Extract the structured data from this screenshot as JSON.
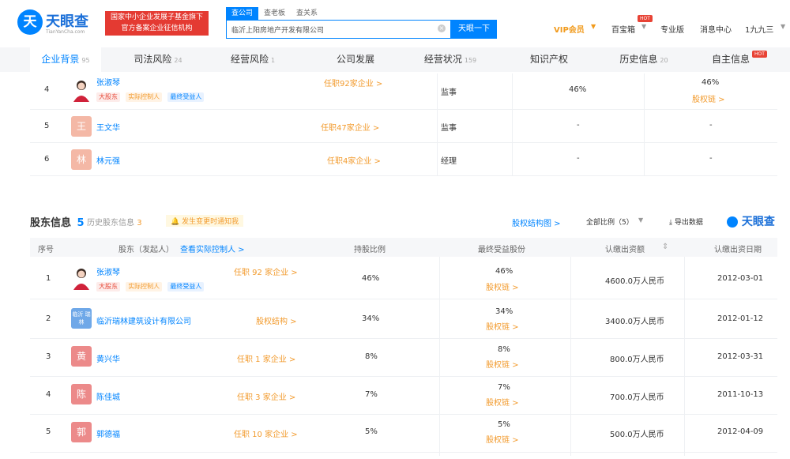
{
  "header": {
    "logo_glyph": "天",
    "logo_name": "天眼查",
    "logo_sub": "TianYanCha.com",
    "promo_line1": "国家中小企业发展子基金旗下",
    "promo_line2": "官方备案企业征信机构",
    "search_tabs": [
      "查公司",
      "查老板",
      "查关系"
    ],
    "search_value": "临沂上阳房地产开发有限公司",
    "search_button": "天眼一下",
    "nav": {
      "vip": "VIP会员",
      "baibao": "百宝箱",
      "hot": "HOT",
      "pro": "专业版",
      "msg": "消息中心",
      "user": "1九九三"
    }
  },
  "tabs": [
    {
      "label": "企业背景",
      "count": "95"
    },
    {
      "label": "司法风险",
      "count": "24"
    },
    {
      "label": "经营风险",
      "count": "1"
    },
    {
      "label": "公司发展",
      "count": ""
    },
    {
      "label": "经营状况",
      "count": "159"
    },
    {
      "label": "知识产权",
      "count": ""
    },
    {
      "label": "历史信息",
      "count": "20"
    },
    {
      "label": "自主信息",
      "count": ""
    }
  ],
  "tab_hot": "HOT",
  "personnel": [
    {
      "no": "4",
      "avatar": "",
      "name": "张淑琴",
      "tags": [
        "大股东",
        "实际控制人",
        "最终受益人"
      ],
      "link": "任职92家企业 >",
      "role": "监事",
      "ratio": "46%",
      "final": "46%",
      "chain": "股权链 >"
    },
    {
      "no": "5",
      "avatar": "王",
      "name": "王文华",
      "tags": [],
      "link": "任职47家企业 >",
      "role": "监事",
      "ratio": "-",
      "final": "-",
      "chain": ""
    },
    {
      "no": "6",
      "avatar": "林",
      "name": "林元强",
      "tags": [],
      "link": "任职4家企业 >",
      "role": "经理",
      "ratio": "-",
      "final": "-",
      "chain": ""
    }
  ],
  "shareholders": {
    "title": "股东信息",
    "count": "5",
    "history_label": "历史股东信息",
    "history_count": "3",
    "notice": "发生变更时通知我",
    "structure_link": "股权结构图 >",
    "filter": "全部比例（5）",
    "export": "导出数据",
    "brand": "天眼查",
    "columns": [
      "序号",
      "股东（发起人）",
      "查看实际控制人 >",
      "持股比例",
      "最终受益股份",
      "认缴出资额",
      "认缴出资日期"
    ],
    "rows": [
      {
        "no": "1",
        "avatar": "",
        "name": "张淑琴",
        "tags": [
          "大股东",
          "实际控制人",
          "最终受益人"
        ],
        "link": "任职 92 家企业 >",
        "ratio": "46%",
        "final": "46%",
        "chain": "股权链 >",
        "amount": "4600.0万人民币",
        "date": "2012-03-01"
      },
      {
        "no": "2",
        "avatar": "临沂 瑞林",
        "name": "临沂瑞林建筑设计有限公司",
        "tags": [],
        "link": "股权结构 >",
        "ratio": "34%",
        "final": "34%",
        "chain": "股权链 >",
        "amount": "3400.0万人民币",
        "date": "2012-01-12"
      },
      {
        "no": "3",
        "avatar": "黄",
        "name": "黄兴华",
        "tags": [],
        "link": "任职 1 家企业 >",
        "ratio": "8%",
        "final": "8%",
        "chain": "股权链 >",
        "amount": "800.0万人民币",
        "date": "2012-03-31"
      },
      {
        "no": "4",
        "avatar": "陈",
        "name": "陈佳城",
        "tags": [],
        "link": "任职 3 家企业 >",
        "ratio": "7%",
        "final": "7%",
        "chain": "股权链 >",
        "amount": "700.0万人民币",
        "date": "2011-10-13"
      },
      {
        "no": "5",
        "avatar": "郭",
        "name": "郭德福",
        "tags": [],
        "link": "任职 10 家企业 >",
        "ratio": "5%",
        "final": "5%",
        "chain": "股权链 >",
        "amount": "500.0万人民币",
        "date": "2012-04-09"
      }
    ]
  },
  "colors": {
    "accent": "#0084ff",
    "link_orange": "#f29b2e",
    "vip": "#f19a1b",
    "promo": "#e43a32"
  }
}
